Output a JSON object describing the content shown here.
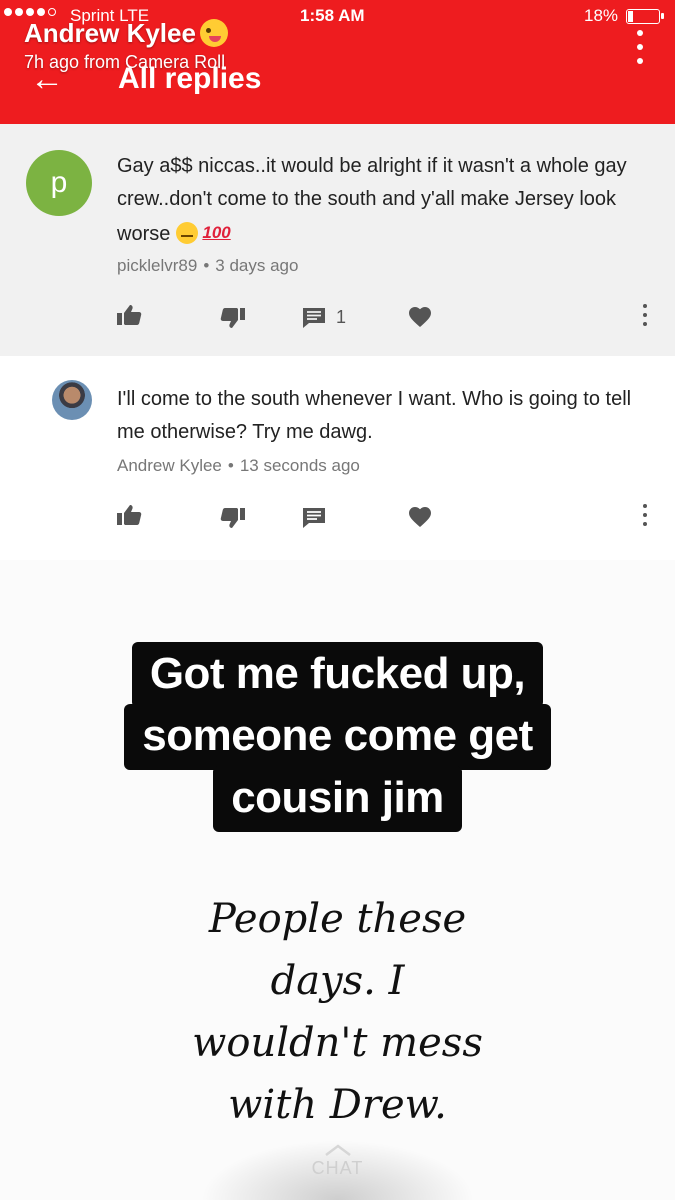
{
  "status_bar": {
    "carrier": "Sprint  LTE",
    "time": "1:58 AM",
    "battery": "18%",
    "battery_level": 0.18
  },
  "story": {
    "name": "Andrew Kylee",
    "meta": "7h ago from Camera Roll"
  },
  "header": {
    "title": "All replies",
    "color": "#ee1c1f"
  },
  "comments": [
    {
      "avatar_letter": "p",
      "avatar_color": "#7cb342",
      "text": "Gay a$$ niccas..it would be alright if it wasn't a whole gay crew..don't come to the south and y'all make Jersey look worse",
      "emoji_hundred": "100",
      "author": "picklelvr89",
      "time": "3 days ago",
      "reply_count": "1"
    },
    {
      "text": "I'll come to the south whenever I want. Who is going to tell me otherwise? Try me dawg.",
      "author": "Andrew Kylee",
      "time": "13 seconds ago"
    }
  ],
  "captions": {
    "line1": "Got me fucked up,",
    "line2": "someone come get",
    "line3": "cousin jim"
  },
  "handwritten": {
    "line1": "People these",
    "line2": "days. I",
    "line3": "wouldn't mess",
    "line4": "with Drew."
  },
  "chat": {
    "label": "CHAT"
  }
}
